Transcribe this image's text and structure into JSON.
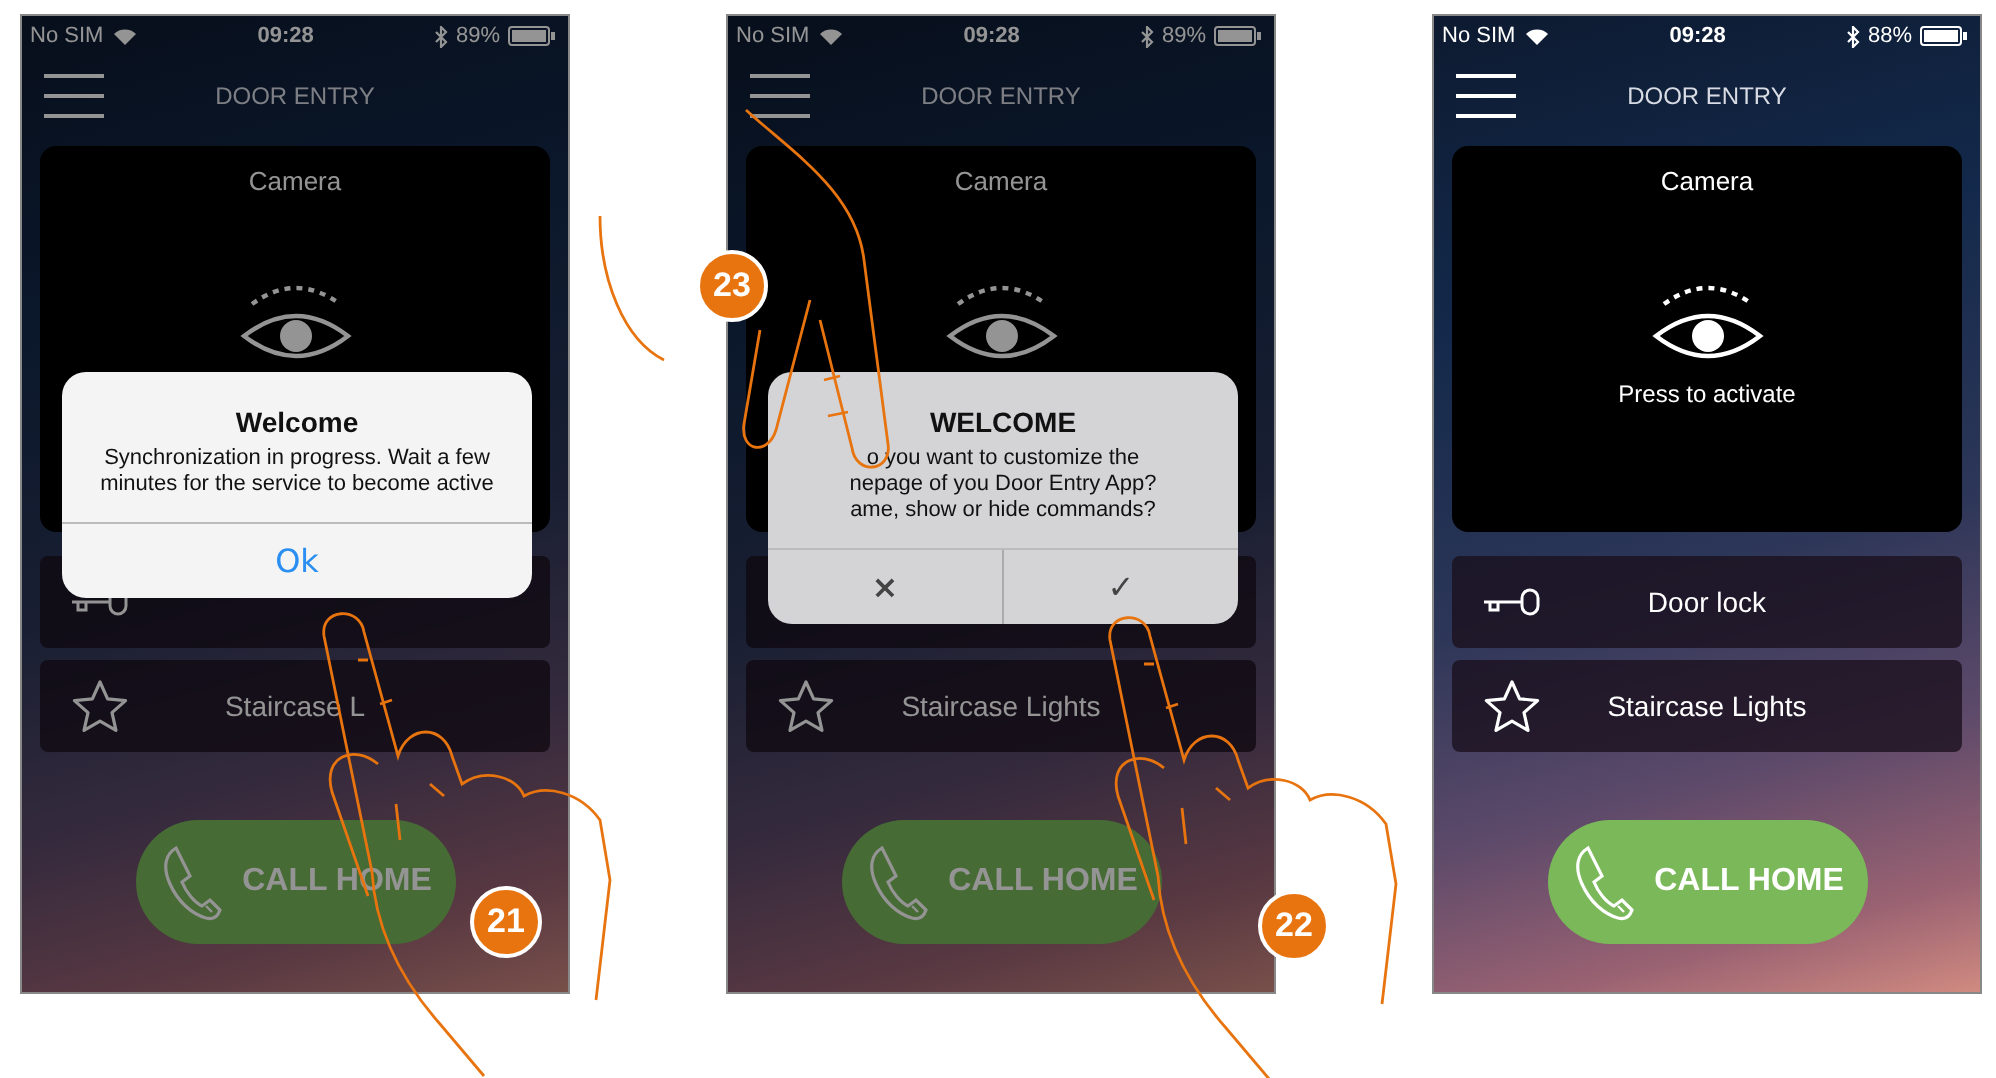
{
  "phones": [
    {
      "status_bar": {
        "carrier": "No SIM",
        "time": "09:28",
        "battery": "89%"
      },
      "header": {
        "title": "DOOR ENTRY"
      },
      "camera": {
        "title": "Camera"
      },
      "commands": [
        {
          "kind": "lock"
        },
        {
          "kind": "star",
          "label": "Staircase L"
        }
      ],
      "call_button": {
        "label": "CALL HOME"
      },
      "dimmed": true,
      "dialog": {
        "kind": "alert",
        "title": "Welcome",
        "message": [
          "Synchronization in progress. Wait a few minutes for the service to become active"
        ],
        "buttons": [
          "Ok"
        ]
      }
    },
    {
      "status_bar": {
        "carrier": "No SIM",
        "time": "09:28",
        "battery": "89%"
      },
      "header": {
        "title": "DOOR ENTRY"
      },
      "camera": {
        "title": "Camera"
      },
      "commands": [
        {
          "kind": "lock"
        },
        {
          "kind": "star",
          "label": "Staircase Lights"
        }
      ],
      "call_button": {
        "label": "CALL HOME"
      },
      "dimmed": true,
      "dialog": {
        "kind": "confirm",
        "title": "WELCOME",
        "message": [
          "o you want to customize the",
          "nepage of you Door Entry App?",
          "ame, show or hide commands?"
        ],
        "buttons": [
          "×",
          "✓"
        ]
      }
    },
    {
      "status_bar": {
        "carrier": "No SIM",
        "time": "09:28",
        "battery": "88%"
      },
      "header": {
        "title": "DOOR ENTRY"
      },
      "camera": {
        "title": "Camera",
        "caption": "Press to activate"
      },
      "commands": [
        {
          "kind": "lock",
          "label": "Door lock"
        },
        {
          "kind": "star",
          "label": "Staircase Lights"
        }
      ],
      "call_button": {
        "label": "CALL HOME"
      },
      "dimmed": false
    }
  ],
  "callouts": [
    {
      "number": "21"
    },
    {
      "number": "22"
    },
    {
      "number": "23"
    }
  ]
}
